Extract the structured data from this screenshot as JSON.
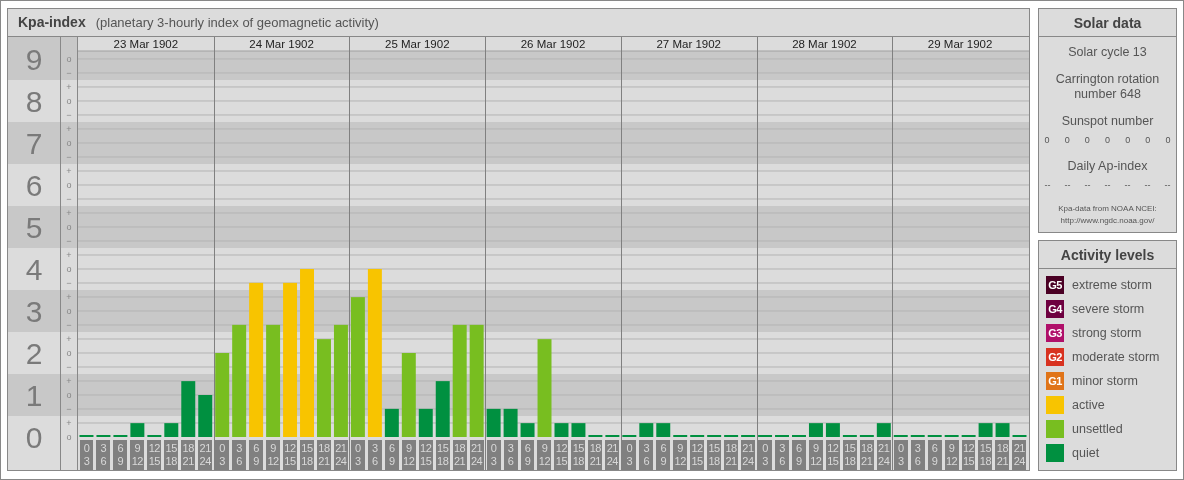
{
  "title": "Kpa-index",
  "subtitle": "(planetary 3-hourly index of geomagnetic activity)",
  "chart": {
    "days": [
      "23 Mar 1902",
      "24 Mar 1902",
      "25 Mar 1902",
      "26 Mar 1902",
      "27 Mar 1902",
      "28 Mar 1902",
      "29 Mar 1902"
    ],
    "minor_marks": [
      "o",
      "−",
      "+",
      "o",
      "−",
      "+",
      "o",
      "−",
      "+",
      "o",
      "−",
      "+",
      "o",
      "−",
      "+",
      "o",
      "−",
      "+",
      "o",
      "−",
      "+",
      "o",
      "−",
      "+",
      "o",
      "−",
      "+",
      "o"
    ],
    "chart_data": {
      "type": "bar",
      "stacked": true,
      "grid": true,
      "ylim": [
        0,
        9.19
      ],
      "yticks": [
        0,
        1,
        2,
        3,
        4,
        5,
        6,
        7,
        8,
        9
      ],
      "categories": [
        "0 3",
        "3 6",
        "6 9",
        "9 12",
        "12 15",
        "15 18",
        "18 21",
        "21 24",
        "0 3",
        "3 6",
        "6 9",
        "9 12",
        "12 15",
        "15 18",
        "18 21",
        "21 24",
        "0 3",
        "3 6",
        "6 9",
        "9 12",
        "12 15",
        "15 18",
        "18 21",
        "21 24",
        "0 3",
        "3 6",
        "6 9",
        "9 12",
        "12 15",
        "15 18",
        "18 21",
        "21 24",
        "0 3",
        "3 6",
        "6 9",
        "9 12",
        "12 15",
        "15 18",
        "18 21",
        "21 24",
        "0 3",
        "3 6",
        "6 9",
        "9 12",
        "12 15",
        "15 18",
        "18 21",
        "21 24",
        "0 3",
        "3 6",
        "6 9",
        "9 12",
        "12 15",
        "15 18",
        "18 21",
        "21 24"
      ],
      "series": [
        {
          "name": "active",
          "color": "#f8c400",
          "values": [
            null,
            null,
            null,
            null,
            null,
            null,
            null,
            null,
            null,
            null,
            3.67,
            null,
            3.67,
            4,
            null,
            null,
            null,
            4,
            null,
            null,
            null,
            null,
            null,
            null,
            null,
            null,
            null,
            null,
            null,
            null,
            null,
            null,
            null,
            null,
            null,
            null,
            null,
            null,
            null,
            null,
            null,
            null,
            null,
            null,
            null,
            null,
            null,
            null,
            null,
            null,
            null,
            null,
            null,
            null,
            null,
            null
          ]
        },
        {
          "name": "unsettled",
          "color": "#78be20",
          "values": [
            null,
            null,
            null,
            null,
            null,
            null,
            null,
            null,
            2,
            2.67,
            null,
            2.67,
            null,
            null,
            2.33,
            2.67,
            3.33,
            null,
            null,
            2,
            null,
            null,
            2.67,
            2.67,
            null,
            null,
            null,
            2.33,
            null,
            null,
            null,
            null,
            null,
            null,
            null,
            null,
            null,
            null,
            null,
            null,
            null,
            null,
            null,
            null,
            null,
            null,
            null,
            null,
            null,
            null,
            null,
            null,
            null,
            null,
            null,
            null
          ]
        },
        {
          "name": "quiet",
          "color": "#009040",
          "values": [
            0,
            0,
            0,
            0.33,
            0,
            0.33,
            1.33,
            1,
            null,
            null,
            null,
            null,
            null,
            null,
            null,
            null,
            null,
            null,
            0.67,
            null,
            0.67,
            1.33,
            null,
            null,
            0.67,
            0.67,
            0.33,
            null,
            0.33,
            0.33,
            0,
            0,
            0,
            0.33,
            0.33,
            0,
            0,
            0,
            0,
            0,
            0,
            0,
            0,
            0.33,
            0.33,
            0,
            0,
            0.33,
            0,
            0,
            0,
            0,
            0,
            0.33,
            0.33,
            0
          ]
        }
      ]
    }
  },
  "solar_data": {
    "title": "Solar data",
    "cycle": "Solar cycle 13",
    "carrington": "Carrington rotation number 648",
    "sunspot_label": "Sunspot number",
    "sunspot_values": [
      "0",
      "0",
      "0",
      "0",
      "0",
      "0",
      "0"
    ],
    "ap_label": "Daily Ap-index",
    "ap_values": [
      "--",
      "--",
      "--",
      "--",
      "--",
      "--",
      "--"
    ],
    "source": "Kpa-data from NOAA NCEI:",
    "source_url": "http://www.ngdc.noaa.gov/"
  },
  "activity_levels": {
    "title": "Activity levels",
    "items": [
      {
        "code": "G5",
        "label": "extreme storm",
        "color": "#4a0024"
      },
      {
        "code": "G4",
        "label": "severe storm",
        "color": "#6e0040"
      },
      {
        "code": "G3",
        "label": "strong storm",
        "color": "#b0106a"
      },
      {
        "code": "G2",
        "label": "moderate storm",
        "color": "#d83220"
      },
      {
        "code": "G1",
        "label": "minor storm",
        "color": "#e07418"
      }
    ]
  }
}
